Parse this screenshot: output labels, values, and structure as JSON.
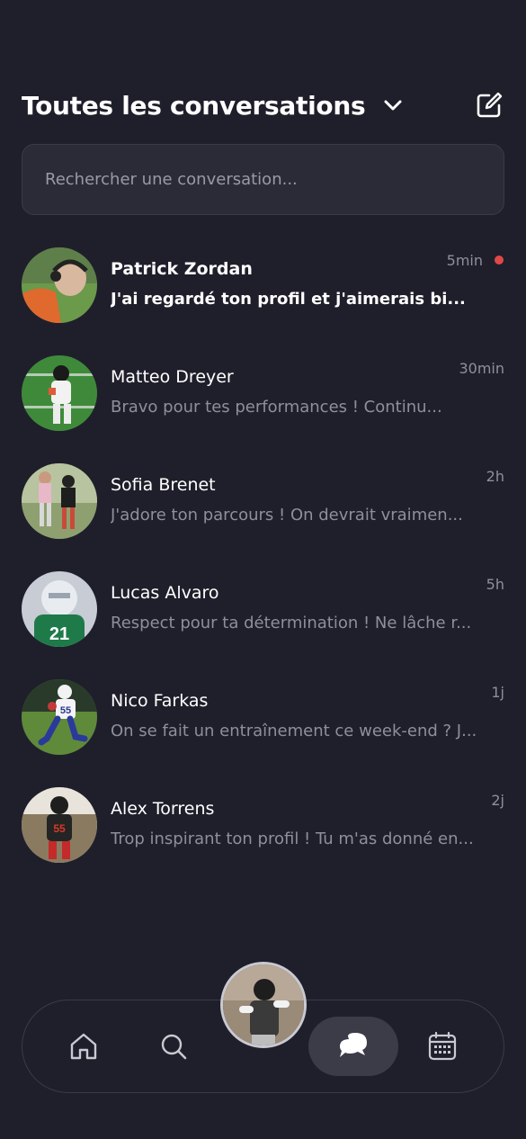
{
  "header": {
    "title": "Toutes les conversations",
    "dropdown_icon": "chevron-down-icon",
    "compose_icon": "compose-icon"
  },
  "search": {
    "placeholder": "Rechercher une conversation..."
  },
  "conversations": [
    {
      "name": "Patrick Zordan",
      "preview": "J'ai regardé ton profil et j'aimerais bi...",
      "time": "5min",
      "unread": true
    },
    {
      "name": "Matteo Dreyer",
      "preview": "Bravo pour tes performances ! Continu...",
      "time": "30min",
      "unread": false
    },
    {
      "name": "Sofia Brenet",
      "preview": "J'adore ton parcours ! On devrait vraimen...",
      "time": "2h",
      "unread": false
    },
    {
      "name": "Lucas Alvaro",
      "preview": "Respect pour ta détermination ! Ne lâche r...",
      "time": "5h",
      "unread": false
    },
    {
      "name": "Nico Farkas",
      "preview": "On se fait un entraînement ce week-end ? J...",
      "time": "1j",
      "unread": false
    },
    {
      "name": "Alex Torrens",
      "preview": "Trop inspirant ton profil ! Tu m'as donné en...",
      "time": "2j",
      "unread": false
    }
  ],
  "nav": {
    "items": [
      "home-icon",
      "search-icon",
      "profile-avatar",
      "chat-icon",
      "calendar-icon"
    ],
    "active": "chat-icon"
  },
  "colors": {
    "background": "#1f1f2b",
    "surface": "#2a2b37",
    "unread_dot": "#e04848",
    "muted_text": "#8f8f9c",
    "active_nav": "#3b3c48"
  }
}
